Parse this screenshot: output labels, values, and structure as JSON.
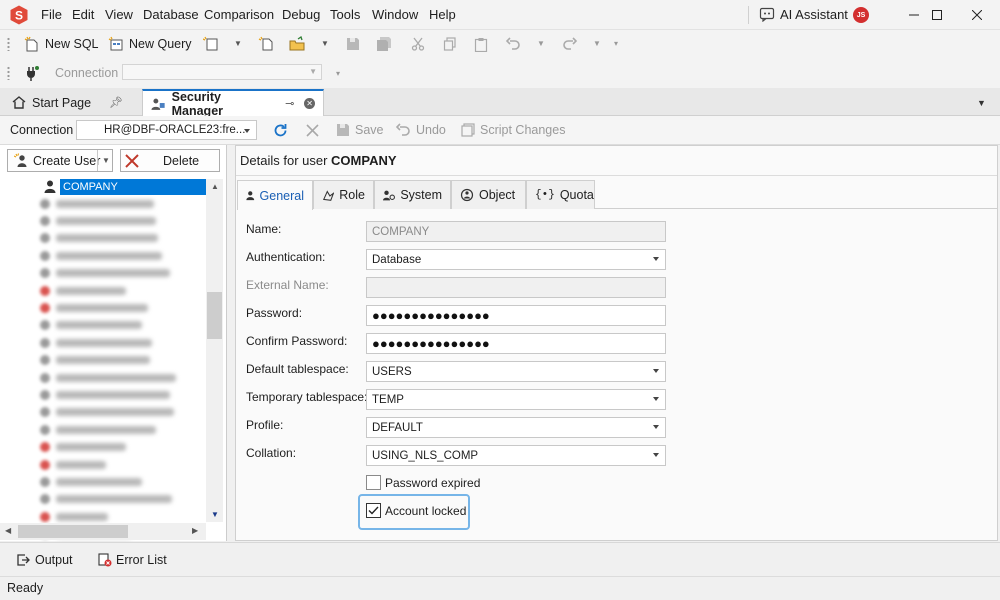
{
  "app": {
    "logo_letter": "S"
  },
  "menu": [
    "File",
    "Edit",
    "View",
    "Database",
    "Comparison",
    "Debug",
    "Tools",
    "Window",
    "Help"
  ],
  "ai_assistant": {
    "label": "AI Assistant"
  },
  "user_avatar": {
    "initials": "JS",
    "color": "#d32f2f"
  },
  "toolbar1": {
    "new_sql": "New SQL",
    "new_query": "New Query"
  },
  "toolbar2": {
    "connection_label": "Connection",
    "connection_value": ""
  },
  "tabs": [
    {
      "label": "Start Page",
      "active": false
    },
    {
      "label": "Security Manager",
      "active": true
    }
  ],
  "connbar": {
    "label": "Connection",
    "value": "HR@DBF-ORACLE23:fre...",
    "save": "Save",
    "undo": "Undo",
    "script_changes": "Script Changes"
  },
  "left": {
    "create_user": "Create User",
    "delete": "Delete",
    "selected_user": "COMPANY",
    "blurred_rows": 20
  },
  "details": {
    "heading_prefix": "Details for user ",
    "heading_user": "COMPANY",
    "tabs": [
      "General",
      "Role",
      "System",
      "Object",
      "Quota"
    ],
    "fields": {
      "name_label": "Name:",
      "name_value": "COMPANY",
      "auth_label": "Authentication:",
      "auth_value": "Database",
      "ext_label": "External Name:",
      "ext_value": "",
      "pwd_label": "Password:",
      "pwd_value": "●●●●●●●●●●●●●●●",
      "cpwd_label": "Confirm Password:",
      "cpwd_value": "●●●●●●●●●●●●●●●",
      "dts_label": "Default tablespace:",
      "dts_value": "USERS",
      "tts_label": "Temporary tablespace:",
      "tts_value": "TEMP",
      "profile_label": "Profile:",
      "profile_value": "DEFAULT",
      "collation_label": "Collation:",
      "collation_value": "USING_NLS_COMP"
    },
    "password_expired": {
      "label": "Password expired",
      "checked": false
    },
    "account_locked": {
      "label": "Account locked",
      "checked": true
    }
  },
  "bottom": {
    "output": "Output",
    "error_list": "Error List"
  },
  "status": {
    "text": "Ready"
  }
}
